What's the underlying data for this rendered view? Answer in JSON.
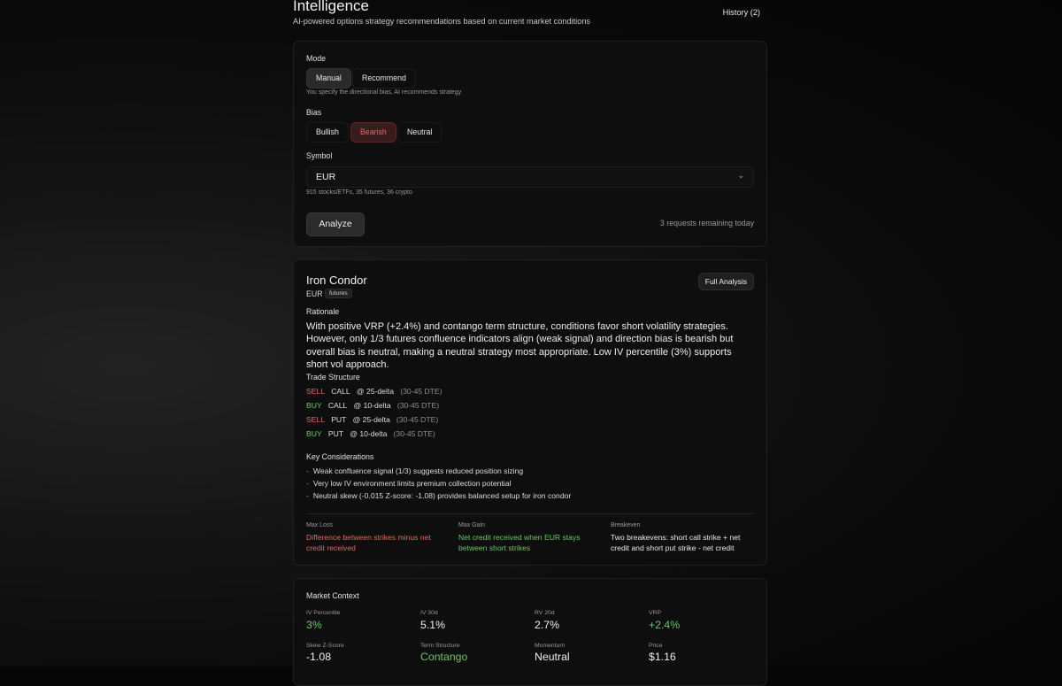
{
  "header": {
    "title": "Intelligence",
    "subtitle": "AI-powered options strategy recommendations based on current market conditions",
    "history_label": "History (2)"
  },
  "form": {
    "mode_label": "Mode",
    "mode_options": [
      "Manual",
      "Recommend"
    ],
    "mode_selected": "Manual",
    "mode_hint": "You specify the directional bias, AI recommends strategy",
    "bias_label": "Bias",
    "bias_options": [
      "Bullish",
      "Bearish",
      "Neutral"
    ],
    "bias_selected": "Bearish",
    "symbol_label": "Symbol",
    "symbol_value": "EUR",
    "symbol_hint": "915 stocks/ETFs, 35 futures, 36 crypto",
    "analyze_label": "Analyze",
    "remaining": "3 requests remaining today"
  },
  "strategy": {
    "name": "Iron Condor",
    "symbol": "EUR",
    "tag": "futures",
    "full_analysis_label": "Full Analysis",
    "rationale_label": "Rationale",
    "rationale": "With positive VRP (+2.4%) and contango term structure, conditions favor short volatility strategies. However, only 1/3 futures confluence indicators align (weak signal) and direction bias is bearish but overall bias is neutral, making a neutral strategy most appropriate. Low IV percentile (3%) supports short vol approach.",
    "trade_structure_label": "Trade Structure",
    "legs": [
      {
        "action": "SELL",
        "type": "CALL",
        "strike": "@ 25-delta",
        "dte": "(30-45 DTE)"
      },
      {
        "action": "BUY",
        "type": "CALL",
        "strike": "@ 10-delta",
        "dte": "(30-45 DTE)"
      },
      {
        "action": "SELL",
        "type": "PUT",
        "strike": "@ 25-delta",
        "dte": "(30-45 DTE)"
      },
      {
        "action": "BUY",
        "type": "PUT",
        "strike": "@ 10-delta",
        "dte": "(30-45 DTE)"
      }
    ],
    "considerations_label": "Key Considerations",
    "considerations": [
      "Weak confluence signal (1/3) suggests reduced position sizing",
      "Very low IV environment limits premium collection potential",
      "Neutral skew (-0.015 Z-score: -1.08) provides balanced setup for iron condor"
    ],
    "max_loss_label": "Max Loss",
    "max_loss": "Difference between strikes minus net credit received",
    "max_gain_label": "Max Gain",
    "max_gain": "Net credit received when EUR stays between short strikes",
    "breakeven_label": "Breakeven",
    "breakeven": "Two breakevens: short call strike + net credit and short put strike - net credit"
  },
  "market_context": {
    "title": "Market Context",
    "metrics": [
      {
        "label": "IV Percentile",
        "value": "3%",
        "color": "#6cc46a"
      },
      {
        "label": "IV 30d",
        "value": "5.1%",
        "color": "#f0f0f0"
      },
      {
        "label": "RV 20d",
        "value": "2.7%",
        "color": "#f0f0f0"
      },
      {
        "label": "VRP",
        "value": "+2.4%",
        "color": "#6cc46a"
      },
      {
        "label": "Skew Z-Score",
        "value": "-1.08",
        "color": "#f0f0f0"
      },
      {
        "label": "Term Structure",
        "value": "Contango",
        "color": "#6cc46a"
      },
      {
        "label": "Momentum",
        "value": "Neutral",
        "color": "#f0f0f0"
      },
      {
        "label": "Price",
        "value": "$1.16",
        "color": "#f0f0f0"
      }
    ]
  }
}
